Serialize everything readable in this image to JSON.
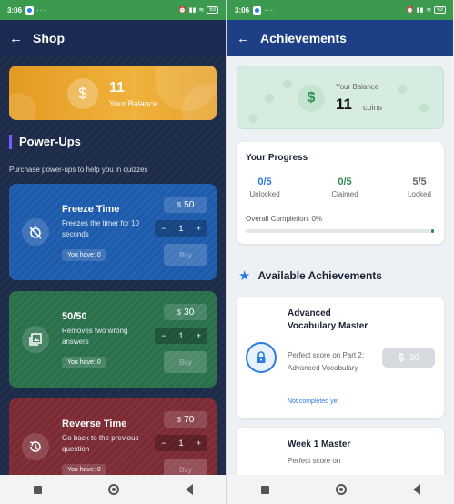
{
  "status": {
    "time": "3:06",
    "dots": "···",
    "battery": "63"
  },
  "shop": {
    "title": "Shop",
    "balance": {
      "amount": "11",
      "label": "Your Balance",
      "currency_symbol": "$"
    },
    "section_title": "Power-Ups",
    "section_desc": "Purchase power-ups to help you in quizzes",
    "items": [
      {
        "name": "Freeze Time",
        "desc": "Freezes the timer for 10 seconds",
        "have": "You have: 0",
        "price": "50",
        "qty": "1",
        "buy": "Buy",
        "color": "blue",
        "icon": "stopwatch-off-icon"
      },
      {
        "name": "50/50",
        "desc": "Removes two wrong answers",
        "have": "You have: 0",
        "price": "30",
        "qty": "1",
        "buy": "Buy",
        "color": "green",
        "icon": "gallery-icon"
      },
      {
        "name": "Reverse Time",
        "desc": "Go back to the previous question",
        "have": "You have: 0",
        "price": "70",
        "qty": "1",
        "buy": "Buy",
        "color": "red",
        "icon": "history-icon"
      }
    ],
    "stepper": {
      "minus": "−",
      "plus": "+"
    }
  },
  "achievements": {
    "title": "Achievements",
    "balance": {
      "label": "Your Balance",
      "amount": "11",
      "unit": "coins",
      "currency_symbol": "$"
    },
    "progress": {
      "title": "Your Progress",
      "unlocked": {
        "value": "0/5",
        "label": "Unlocked"
      },
      "claimed": {
        "value": "0/5",
        "label": "Claimed"
      },
      "locked": {
        "value": "5/5",
        "label": "Locked"
      },
      "completion": "Overall Completion: 0%",
      "percent": 0
    },
    "available_title": "Available Achievements",
    "cards": [
      {
        "name": "Advanced Vocabulary Master",
        "desc": "Perfect score on Part 2: Advanced Vocabulary",
        "status": "Not completed yet",
        "reward": "30"
      },
      {
        "name": "Week 1 Master",
        "desc": "Perfect score on"
      }
    ]
  },
  "colors": {
    "status_bar": "#3c9a4f",
    "shop_appbar": "#1b2a52",
    "ach_appbar": "#1d3f86",
    "accent_green": "#2e8d52",
    "accent_blue": "#2d7be5"
  }
}
